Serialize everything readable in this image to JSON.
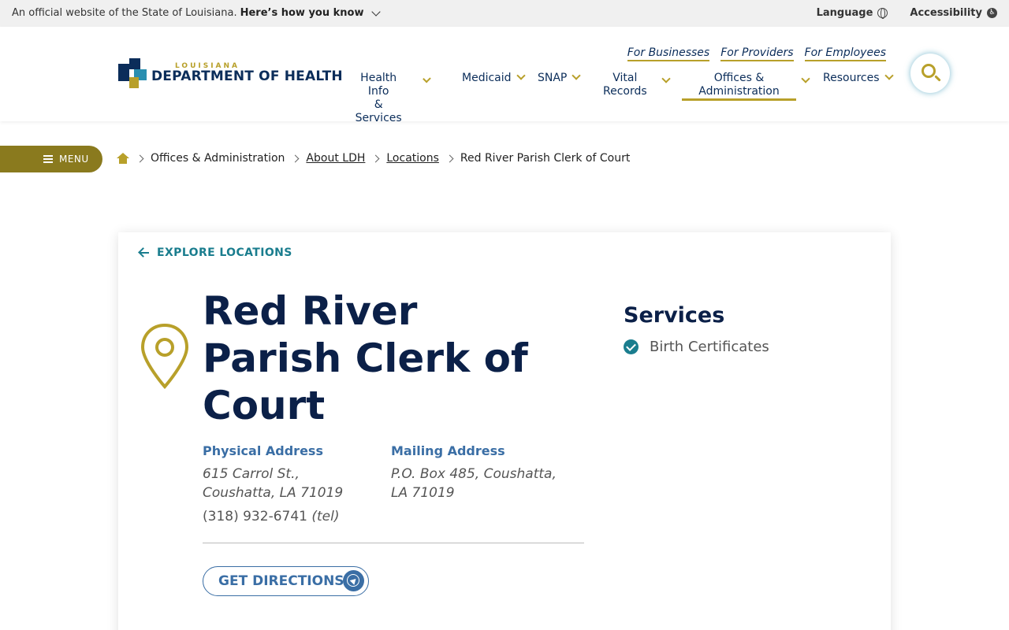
{
  "banner": {
    "official_text": "An official website of the State of Louisiana.",
    "how_you_know": "Here’s how you know",
    "language": "Language",
    "accessibility": "Accessibility"
  },
  "logo": {
    "top": "LOUISIANA",
    "main": "DEPARTMENT OF HEALTH"
  },
  "top_links": [
    "For Businesses",
    "For Providers",
    "For Employees"
  ],
  "nav": [
    {
      "line1": "Health Info",
      "line2": "& Services"
    },
    {
      "line1": "Medicaid",
      "line2": ""
    },
    {
      "line1": "SNAP",
      "line2": ""
    },
    {
      "line1": "Vital",
      "line2": "Records"
    },
    {
      "line1": "Offices &",
      "line2": "Administration"
    },
    {
      "line1": "Resources",
      "line2": ""
    }
  ],
  "menu_label": "MENU",
  "breadcrumb": [
    "Offices & Administration",
    "About LDH",
    "Locations",
    "Red River Parish Clerk of Court"
  ],
  "card": {
    "back_label": "EXPLORE LOCATIONS",
    "title": "Red River Parish Clerk of Court",
    "physical": {
      "heading": "Physical Address",
      "value": "615 Carrol St., Coushatta, LA 71019",
      "phone": "(318) 932-6741",
      "phone_type": "(tel)"
    },
    "mailing": {
      "heading": "Mailing Address",
      "value": "P.O. Box 485, Coushatta, LA 71019"
    },
    "directions_label": "GET DIRECTIONS",
    "services_heading": "Services",
    "services": [
      "Birth Certificates"
    ]
  },
  "colors": {
    "navy": "#0b2048",
    "gold": "#b8a02a",
    "teal": "#1a7d8e",
    "link_blue": "#3a6ea5",
    "menu_olive": "#8a7a1e"
  }
}
